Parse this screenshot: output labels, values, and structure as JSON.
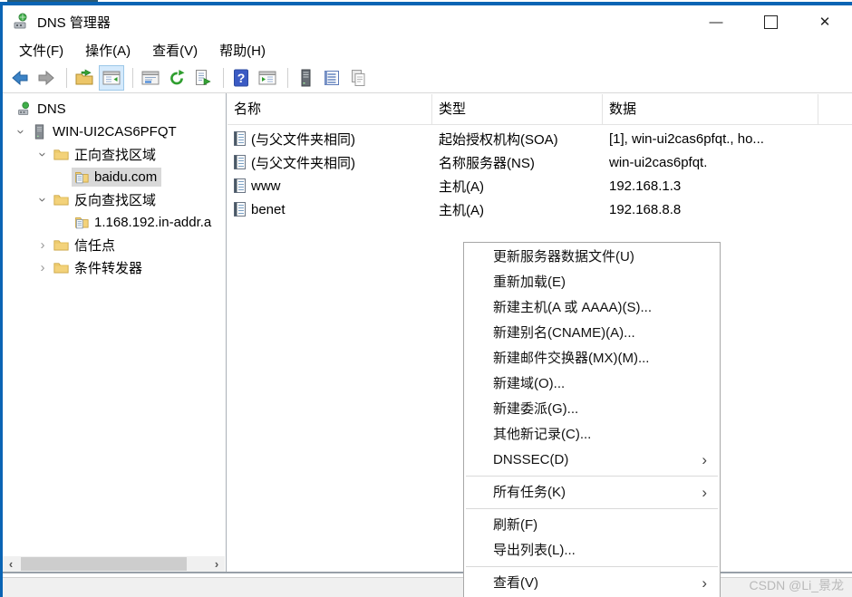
{
  "window": {
    "title": "DNS 管理器",
    "controls": {
      "minimize": "—",
      "close": "✕"
    }
  },
  "menubar": {
    "items": [
      {
        "label": "文件(F)"
      },
      {
        "label": "操作(A)"
      },
      {
        "label": "查看(V)"
      },
      {
        "label": "帮助(H)"
      }
    ]
  },
  "toolbar": {
    "icons": [
      "back",
      "forward",
      "export-folder",
      "show-console-tree",
      "properties-window",
      "refresh",
      "export-list",
      "help",
      "show-window",
      "server",
      "record-list",
      "copy"
    ]
  },
  "tree": {
    "items": [
      {
        "label": "DNS",
        "icon": "dns-root"
      },
      {
        "label": "WIN-UI2CAS6PFQT",
        "icon": "server",
        "state": "expanded"
      },
      {
        "label": "正向查找区域",
        "icon": "folder",
        "state": "expanded"
      },
      {
        "label": "baidu.com",
        "icon": "zone",
        "selected": true
      },
      {
        "label": "反向查找区域",
        "icon": "folder",
        "state": "expanded"
      },
      {
        "label": "1.168.192.in-addr.a",
        "icon": "zone"
      },
      {
        "label": "信任点",
        "icon": "folder",
        "state": "collapsed"
      },
      {
        "label": "条件转发器",
        "icon": "folder",
        "state": "collapsed"
      }
    ],
    "scrollbar": {
      "left_arrow": "‹",
      "right_arrow": "›"
    }
  },
  "list": {
    "columns": [
      {
        "label": "名称"
      },
      {
        "label": "类型"
      },
      {
        "label": "数据"
      }
    ],
    "rows": [
      {
        "name": "(与父文件夹相同)",
        "type": "起始授权机构(SOA)",
        "data": "[1], win-ui2cas6pfqt., ho..."
      },
      {
        "name": "(与父文件夹相同)",
        "type": "名称服务器(NS)",
        "data": "win-ui2cas6pfqt."
      },
      {
        "name": "www",
        "type": "主机(A)",
        "data": "192.168.1.3"
      },
      {
        "name": "benet",
        "type": "主机(A)",
        "data": "192.168.8.8"
      }
    ]
  },
  "context_menu": {
    "submenu_arrow": "›",
    "items": [
      {
        "label": "更新服务器数据文件(U)"
      },
      {
        "label": "重新加载(E)"
      },
      {
        "label": "新建主机(A 或 AAAA)(S)..."
      },
      {
        "label": "新建别名(CNAME)(A)..."
      },
      {
        "label": "新建邮件交换器(MX)(M)..."
      },
      {
        "label": "新建域(O)..."
      },
      {
        "label": "新建委派(G)..."
      },
      {
        "label": "其他新记录(C)..."
      },
      {
        "label": "DNSSEC(D)",
        "submenu": true
      },
      {
        "label": "所有任务(K)",
        "submenu": true
      },
      {
        "label": "刷新(F)"
      },
      {
        "label": "导出列表(L)..."
      },
      {
        "label": "查看(V)",
        "submenu": true
      }
    ]
  },
  "watermark": "CSDN @Li_景龙",
  "colors": {
    "accent_border": "#0a64b4",
    "selection_bg": "#d9d9d9",
    "toolbar_selected_bg": "#d5eafc",
    "toolbar_selected_border": "#9cc7e8",
    "status_bg": "#f0f0f0"
  }
}
